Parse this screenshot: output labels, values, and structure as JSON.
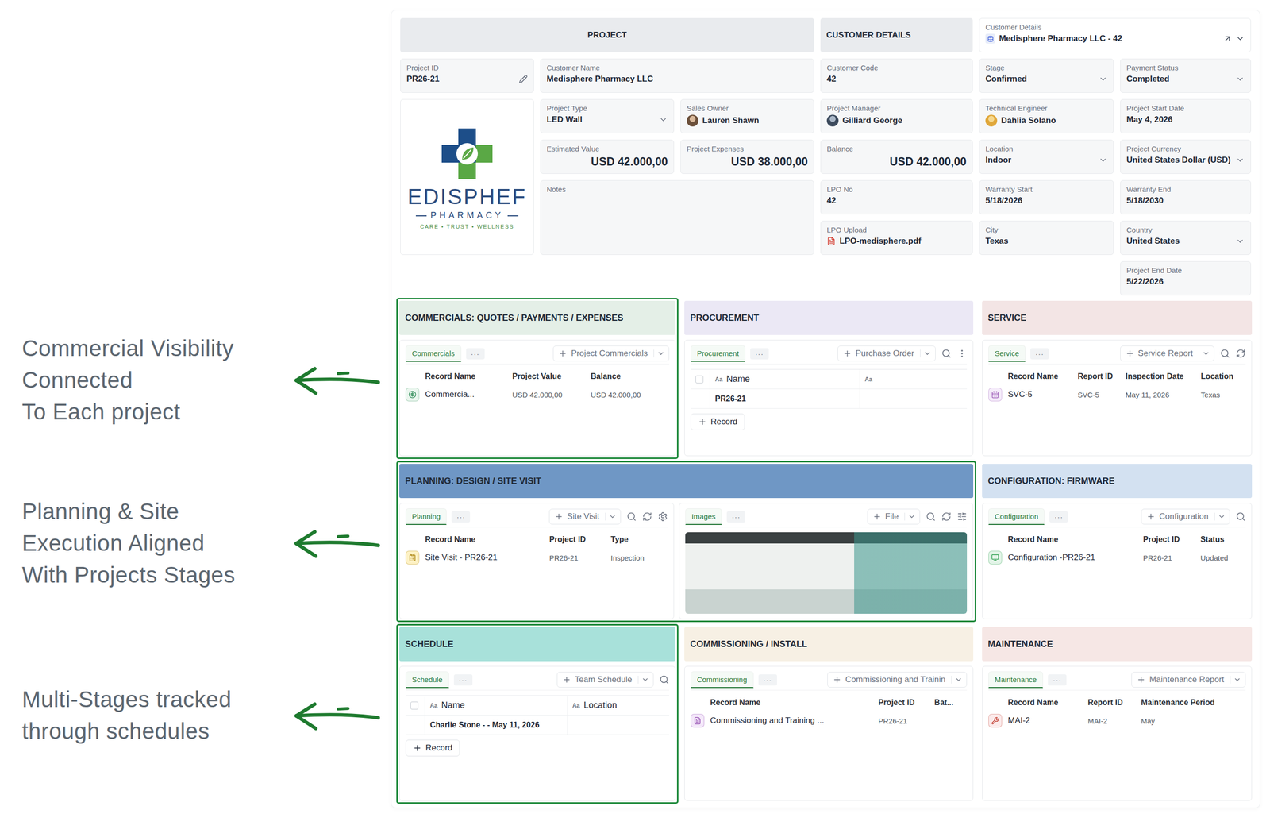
{
  "annotations": [
    {
      "lines": [
        "Commercial Visibility",
        "Connected",
        "To Each project"
      ]
    },
    {
      "lines": [
        "Planning & Site",
        "Execution Aligned",
        "With Projects Stages"
      ]
    },
    {
      "lines": [
        "Multi-Stages tracked",
        "through schedules"
      ]
    }
  ],
  "header": {
    "project": "PROJECT",
    "customer_details": "CUSTOMER DETAILS",
    "lookup": {
      "label": "Customer Details",
      "value": "Medisphere Pharmacy LLC - 42"
    }
  },
  "logo": {
    "name": "EDISPHEF",
    "sub": "PHARMACY",
    "tagline": "CARE • TRUST • WELLNESS"
  },
  "fields": [
    {
      "label": "Project ID",
      "value": "PR26-21",
      "kind": "editable"
    },
    {
      "label": "Customer Name",
      "value": "Medisphere Pharmacy LLC",
      "kind": "text"
    },
    {
      "label": "Customer Code",
      "value": "42",
      "kind": "text"
    },
    {
      "label": "Stage",
      "value": "Confirmed",
      "kind": "dropdown"
    },
    {
      "label": "Payment Status",
      "value": "Completed",
      "kind": "dropdown"
    },
    {
      "label": "Project Type",
      "value": "LED Wall",
      "kind": "dropdown"
    },
    {
      "label": "Sales Owner",
      "value": "Lauren Shawn",
      "kind": "user"
    },
    {
      "label": "Project Manager",
      "value": "Gilliard George",
      "kind": "user"
    },
    {
      "label": "Technical Engineer",
      "value": "Dahlia Solano",
      "kind": "user"
    },
    {
      "label": "Project Start Date",
      "value": "May 4, 2026",
      "kind": "text"
    },
    {
      "label": "Estimated Value",
      "value": "USD 42.000,00",
      "kind": "money"
    },
    {
      "label": "Project Expenses",
      "value": "USD 38.000,00",
      "kind": "money"
    },
    {
      "label": "Balance",
      "value": "USD 42.000,00",
      "kind": "money"
    },
    {
      "label": "Location",
      "value": "Indoor",
      "kind": "dropdown"
    },
    {
      "label": "Project Currency",
      "value": "United States Dollar (USD)",
      "kind": "dropdown"
    },
    {
      "label": "Notes",
      "value": "",
      "kind": "notes"
    },
    {
      "label": "LPO No",
      "value": "42",
      "kind": "text"
    },
    {
      "label": "Warranty Start",
      "value": "5/18/2026",
      "kind": "text"
    },
    {
      "label": "Warranty End",
      "value": "5/18/2030",
      "kind": "text"
    },
    {
      "label": "LPO Upload",
      "value": "LPO-medisphere.pdf",
      "kind": "file"
    },
    {
      "label": "City",
      "value": "Texas",
      "kind": "text"
    },
    {
      "label": "Country",
      "value": "United States",
      "kind": "dropdown"
    },
    {
      "label": "Project End Date",
      "value": "5/22/2026",
      "kind": "text"
    }
  ],
  "sections": [
    {
      "title": "COMMERCIALS: QUOTES / PAYMENTS / EXPENSES",
      "color": "#e4efe7",
      "highlighted": true,
      "cards": [
        {
          "tab": {
            "label": "Commercials",
            "selected": true
          },
          "more": "···",
          "add": "Project Commercials",
          "kind": "table",
          "columns": [
            "Record Name",
            "Project Value",
            "Balance"
          ],
          "rows": [
            [
              "Commercia...",
              "USD 42.000,00",
              "USD 42.000,00"
            ]
          ]
        }
      ]
    },
    {
      "title": "PROCUREMENT",
      "color": "#ebe8f5",
      "highlighted": false,
      "cards": [
        {
          "tab": {
            "label": "Procurement",
            "selected": true
          },
          "more": "···",
          "add": "Purchase Order",
          "kind": "grid",
          "columns": [
            {
              "glyph": "Aa",
              "label": "Name"
            },
            {
              "glyph": "Aa",
              "label": ""
            }
          ],
          "rows": [
            [
              "PR26-21",
              ""
            ]
          ],
          "record": "Record"
        }
      ]
    },
    {
      "title": "SERVICE",
      "color": "#f3e5e5",
      "highlighted": false,
      "cards": [
        {
          "tab": {
            "label": "Service",
            "selected": true
          },
          "more": "···",
          "add": "Service Report",
          "kind": "table",
          "columns": [
            "Record Name",
            "Report ID",
            "Inspection Date",
            "Location"
          ],
          "rows": [
            [
              "SVC-5",
              "SVC-5",
              "May 11, 2026",
              "Texas"
            ]
          ]
        }
      ]
    },
    {
      "title": "PLANNING: DESIGN / SITE VISIT",
      "color": "#6f97c5",
      "highlighted": true,
      "cards": [
        {
          "tab": {
            "label": "Planning",
            "selected": true
          },
          "more": "···",
          "add": "Site Visit",
          "kind": "table",
          "columns": [
            "Record Name",
            "Project ID",
            "Type"
          ],
          "rows": [
            [
              "Site Visit - PR26-21",
              "PR26-21",
              "Inspection"
            ]
          ]
        },
        {
          "tab": {
            "label": "Images",
            "selected": true
          },
          "more": "···",
          "add": "File",
          "kind": "gallery"
        }
      ]
    },
    {
      "title": "CONFIGURATION: FIRMWARE",
      "color": "#d3e1f1",
      "highlighted": false,
      "cards": [
        {
          "tab": {
            "label": "Configuration",
            "selected": true
          },
          "more": "···",
          "add": "Configuration",
          "kind": "table",
          "columns": [
            "Record Name",
            "Project ID",
            "Status"
          ],
          "rows": [
            [
              "Configuration -PR26-21",
              "PR26-21",
              "Updated"
            ]
          ]
        }
      ]
    },
    {
      "title": "SCHEDULE",
      "color": "#a8e1da",
      "highlighted": true,
      "cards": [
        {
          "tab": {
            "label": "Schedule",
            "selected": true
          },
          "more": "···",
          "add": "Team Schedule",
          "kind": "grid",
          "columns": [
            {
              "glyph": "Aa",
              "label": "Name"
            },
            {
              "glyph": "Aa",
              "label": "Location"
            }
          ],
          "rows": [
            [
              "Charlie Stone - - May 11, 2026",
              ""
            ]
          ],
          "record": "Record"
        }
      ]
    },
    {
      "title": "COMMISSIONING / INSTALL",
      "color": "#f7f0e4",
      "highlighted": false,
      "cards": [
        {
          "tab": {
            "label": "Commissioning",
            "selected": true
          },
          "more": "···",
          "add": "Commissioning and Trainin",
          "kind": "table",
          "columns": [
            "Record Name",
            "Project ID",
            "Bat..."
          ],
          "rows": [
            [
              "Commissioning and Training ...",
              "PR26-21",
              ""
            ]
          ]
        }
      ]
    },
    {
      "title": "MAINTENANCE",
      "color": "#f6e7e5",
      "highlighted": false,
      "cards": [
        {
          "tab": {
            "label": "Maintenance",
            "selected": true
          },
          "more": "···",
          "add": "Maintenance Report",
          "kind": "table",
          "columns": [
            "Record Name",
            "Report ID",
            "Maintenance Period"
          ],
          "rows": [
            [
              "MAI-2",
              "MAI-2",
              "May"
            ]
          ]
        }
      ]
    }
  ]
}
